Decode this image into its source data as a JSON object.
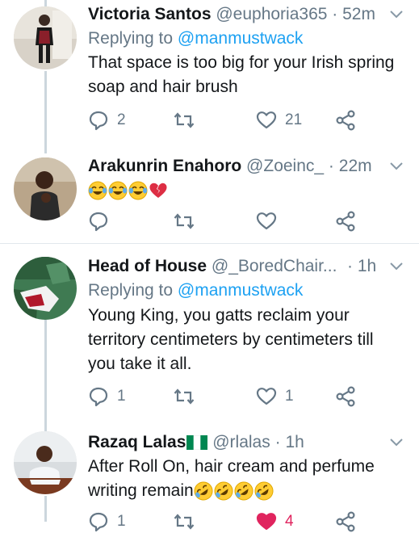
{
  "tweets": [
    {
      "display_name": "Victoria Santos",
      "handle": "@euphoria365",
      "separator": "·",
      "time": "52m",
      "replying_prefix": "Replying to ",
      "replying_to": "@manmustwack",
      "text_lines": [
        "That space is too big for your Irish spring",
        "soap and hair brush"
      ],
      "reply_count": "2",
      "retweet_count": "",
      "like_count": "21"
    },
    {
      "display_name": "Arakunrin Enahoro",
      "handle": "@Zoeinc_",
      "separator": "·",
      "time": "22m",
      "emojis": [
        "face-with-tears-of-joy",
        "face-with-tears-of-joy",
        "face-with-tears-of-joy",
        "broken-heart"
      ],
      "reply_count": "",
      "retweet_count": "",
      "like_count": ""
    },
    {
      "display_name": "Head of House",
      "handle": "@_BoredChair...",
      "separator": "·",
      "time": "1h",
      "replying_prefix": "Replying to ",
      "replying_to": "@manmustwack",
      "text_lines": [
        "Young King, you gatts reclaim your",
        "territory centimeters by centimeters till",
        "you take it all."
      ],
      "reply_count": "1",
      "retweet_count": "",
      "like_count": "1"
    },
    {
      "display_name": "Razaq Lalas",
      "flag": "nigeria-flag",
      "handle": "@rlalas",
      "separator": "·",
      "time": "1h",
      "text_lines": [
        "After Roll On, hair cream and perfume",
        "writing remain"
      ],
      "trailing_emojis": [
        "rolling-on-the-floor-laughing",
        "rolling-on-the-floor-laughing",
        "rolling-on-the-floor-laughing",
        "rolling-on-the-floor-laughing"
      ],
      "reply_count": "1",
      "retweet_count": "",
      "like_count": "4",
      "liked": true
    }
  ],
  "colors": {
    "name": "#14171a",
    "secondary": "#657786",
    "link": "#1da1f2",
    "divider": "#e1e8ed",
    "thread": "#ccd6dd",
    "liked": "#e0245e"
  },
  "icons": {
    "reply": "speech-bubble-icon",
    "retweet": "retweet-arrows-icon",
    "like": "heart-icon",
    "share": "share-nodes-icon",
    "menu": "chevron-down-icon"
  }
}
